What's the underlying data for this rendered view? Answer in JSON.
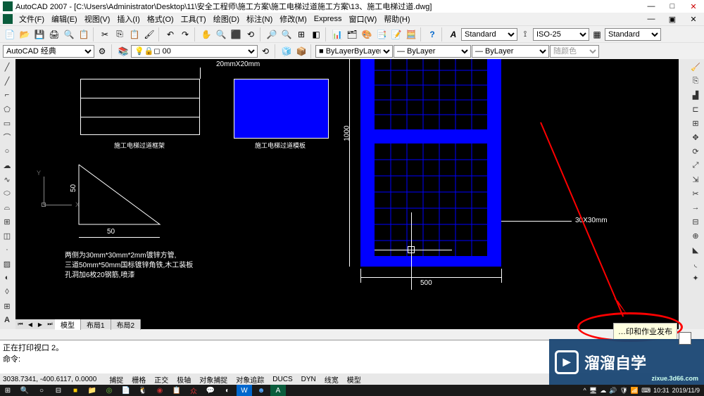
{
  "title": "AutoCAD 2007 - [C:\\Users\\Administrator\\Desktop\\11\\安全工程师\\施工方案\\施工电梯过道施工方案\\13、施工电梯过道.dwg]",
  "menu": [
    "文件(F)",
    "编辑(E)",
    "视图(V)",
    "插入(I)",
    "格式(O)",
    "工具(T)",
    "绘图(D)",
    "标注(N)",
    "修改(M)",
    "Express",
    "窗口(W)",
    "帮助(H)"
  ],
  "toolbar2": {
    "workspace": "AutoCAD 经典",
    "layer": "0",
    "style1": "Standard",
    "style2": "ISO-25",
    "style3": "Standard",
    "color_label": "随颜色",
    "bylayer": "ByLayer"
  },
  "canvas": {
    "dim_top": "20mmX20mm",
    "label1": "施工电梯过道框架",
    "label2": "施工电梯过道模板",
    "dim_1000": "1000",
    "dim_500": "500",
    "dim_50h": "50",
    "dim_50v": "50",
    "dim_30": "30X30mm",
    "note1": "两侧为30mm*30mm*2mm镀锌方管,",
    "note2": "三道50mm*50mm国标镀锌角铁,木工装板",
    "note3": "孔洞加6枚20钢筋,喷漆",
    "ucs_x": "X",
    "ucs_y": "Y"
  },
  "tabs": {
    "model": "模型",
    "layout1": "布局1",
    "layout2": "布局2"
  },
  "command": {
    "line1": "正在打印视口 2。",
    "prompt": "命令:"
  },
  "status": {
    "coords": "3038.7341, -400.6117, 0.0000",
    "buttons": [
      "捕捉",
      "栅格",
      "正交",
      "极轴",
      "对象捕捉",
      "对象追踪",
      "DUCS",
      "DYN",
      "线宽",
      "模型"
    ]
  },
  "tray": {
    "time": "10:31",
    "date": "2019/11/9"
  },
  "watermark": {
    "text": "溜溜自学",
    "url": "zixue.3d66.com"
  },
  "popup_text": "…印和作业发布"
}
